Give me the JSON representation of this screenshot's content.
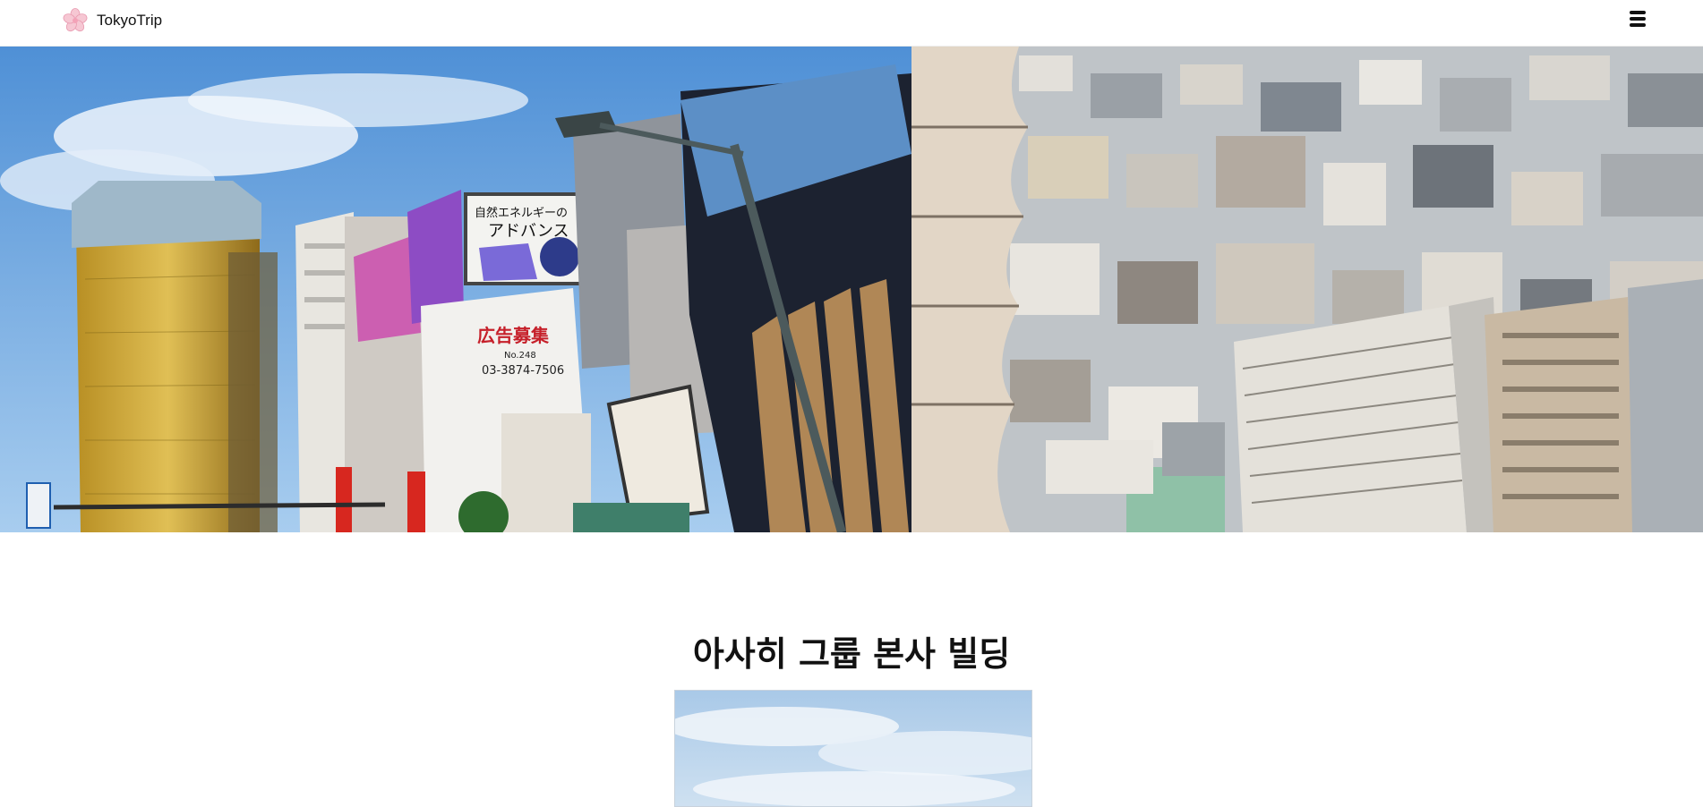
{
  "header": {
    "brand_name": "TokyoTrip",
    "logo_icon": "cherry-blossom-icon",
    "menu_icon": "hamburger-menu-icon"
  },
  "hero": {
    "left_image": "asakusa-street-photo",
    "right_image": "tokyo-aerial-cityscape-photo",
    "signs": {
      "billboard_line1": "自然エネルギーの",
      "billboard_line2": "アドバンス",
      "ad_title": "広告募集",
      "ad_no": "No.248",
      "ad_phone": "03-3874-7506"
    }
  },
  "main": {
    "section_title": "아사히 그룹 본사 빌딩",
    "section_image": "asahi-building-sky-photo"
  },
  "colors": {
    "sky": "#6aa6df",
    "gold_tower": "#c9a43a",
    "text": "#111111"
  }
}
